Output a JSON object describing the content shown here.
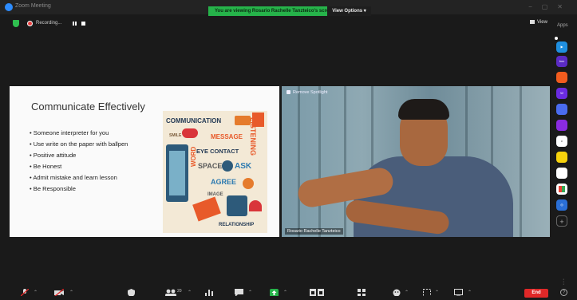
{
  "window": {
    "title": "Zoom Meeting",
    "share_banner": "You are viewing Rosario Rachelle Tanzteico's screen",
    "view_options": "View Options"
  },
  "status": {
    "recording_label": "Recording..."
  },
  "top_right": {
    "view_label": "View",
    "apps_label": "Apps"
  },
  "slide": {
    "title": "Communicate Effectively",
    "bullets": [
      "Someone interpreter for you",
      "Use  write on the paper with ballpen",
      "Positive attitude",
      "Be Honest",
      "Admit mistake and learn lesson",
      "Be Responsible"
    ],
    "collage_words": {
      "communication": "COMMUNICATION",
      "message": "MESSAGE",
      "eye_contact": "EYE CONTACT",
      "listening": "LISTENING",
      "space": "SPACE",
      "ask": "ASK",
      "agree": "AGREE",
      "word": "WORD",
      "smile": "SMILE",
      "image": "IMAGE",
      "relationship": "RELATIONSHIP"
    }
  },
  "video": {
    "spotlight_label": "Remove Spotlight",
    "participant_name": "Rosario Rachelle Tanzteico"
  },
  "toolbar": {
    "participants_count": "20",
    "end_label": "End",
    "help_glyph": "?"
  },
  "colors": {
    "share_banner_bg": "#26b34a",
    "end_button_bg": "#e02828",
    "zoom_blue": "#2d8cff",
    "record_red": "#e84040"
  }
}
